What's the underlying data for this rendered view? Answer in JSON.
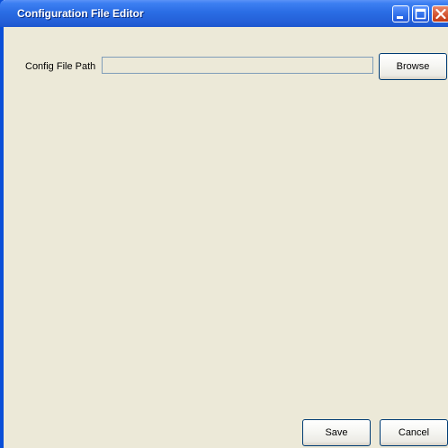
{
  "window": {
    "title": "Configuration File Editor",
    "controls": [
      "minimize-icon",
      "maximize-icon",
      "close-icon"
    ]
  },
  "form": {
    "path_label": "Config File Path",
    "path_value": "",
    "browse_label": "Browse"
  },
  "footer": {
    "save_label": "Save",
    "cancel_label": "Cancel"
  },
  "colors": {
    "titlebar": "#2a6de4",
    "window_bg": "#ece9d8",
    "border": "#0a4fd8",
    "close_button": "#d2522e"
  }
}
